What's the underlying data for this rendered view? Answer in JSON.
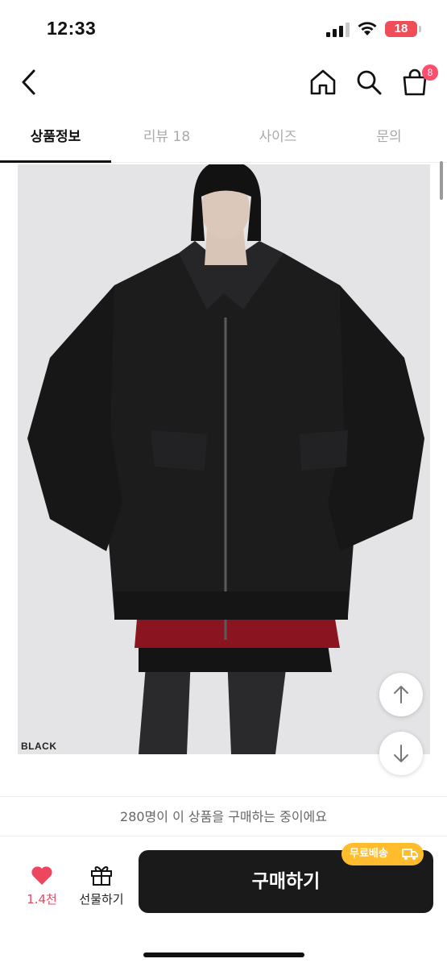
{
  "status_bar": {
    "time": "12:33",
    "battery": "18"
  },
  "nav": {
    "cart_count": "8"
  },
  "tabs": [
    {
      "label": "상품정보"
    },
    {
      "label": "리뷰 18"
    },
    {
      "label": "사이즈"
    },
    {
      "label": "문의"
    }
  ],
  "product_image": {
    "caption": "BLACK"
  },
  "notice": {
    "text": "280명이 이 상품을 구매하는 중이에요"
  },
  "bottom_bar": {
    "like_count": "1.4천",
    "gift_label": "선물하기",
    "buy_label": "구매하기",
    "shipping_badge": "무료배송"
  },
  "colors": {
    "accent_red": "#ef4660",
    "badge_pink": "#ff4d6d",
    "buy_button": "#1a1a1a",
    "shipping_badge": "#ffbd2e"
  }
}
